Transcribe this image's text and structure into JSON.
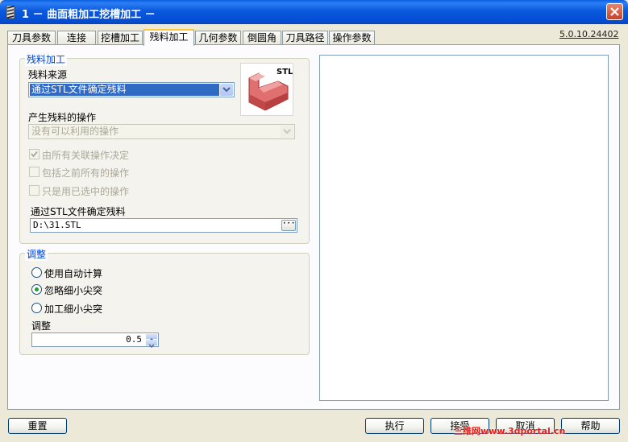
{
  "window": {
    "title": "1 － 曲面粗加工挖槽加工 －"
  },
  "tabs": [
    "刀具参数",
    "连接",
    "挖槽加工",
    "残料加工",
    "几何参数",
    "倒圆角",
    "刀具路径",
    "操作参数"
  ],
  "version": "5.0.10.24402",
  "rest_group": {
    "legend": "残料加工",
    "source_label": "残料来源",
    "source_value": "通过STL文件确定残料",
    "image_text": "STL",
    "operation_label": "产生残料的操作",
    "operation_value": "没有可以利用的操作",
    "checkboxes": [
      {
        "label": "由所有关联操作决定",
        "checked": true
      },
      {
        "label": "包括之前所有的操作",
        "checked": false
      },
      {
        "label": "只是用已选中的操作",
        "checked": false
      }
    ],
    "stl_label": "通过STL文件确定残料",
    "stl_path": "D:\\31.STL",
    "browse_symbol": "···"
  },
  "adjust_group": {
    "legend": "调整",
    "radios": [
      {
        "label": "使用自动计算",
        "selected": false
      },
      {
        "label": "忽略细小尖突",
        "selected": true
      },
      {
        "label": "加工细小尖突",
        "selected": false
      }
    ],
    "amount_label": "调整",
    "amount_value": "0.5"
  },
  "buttons": {
    "reset": "重置",
    "execute": "执行",
    "apply": "接受",
    "cancel": "取消",
    "help": "帮助"
  },
  "watermark": "三维网www.3dportal.cn",
  "colors": {
    "title_bar": "#0a59de",
    "group_legend": "#0046d5",
    "selection": "#316ac5"
  }
}
